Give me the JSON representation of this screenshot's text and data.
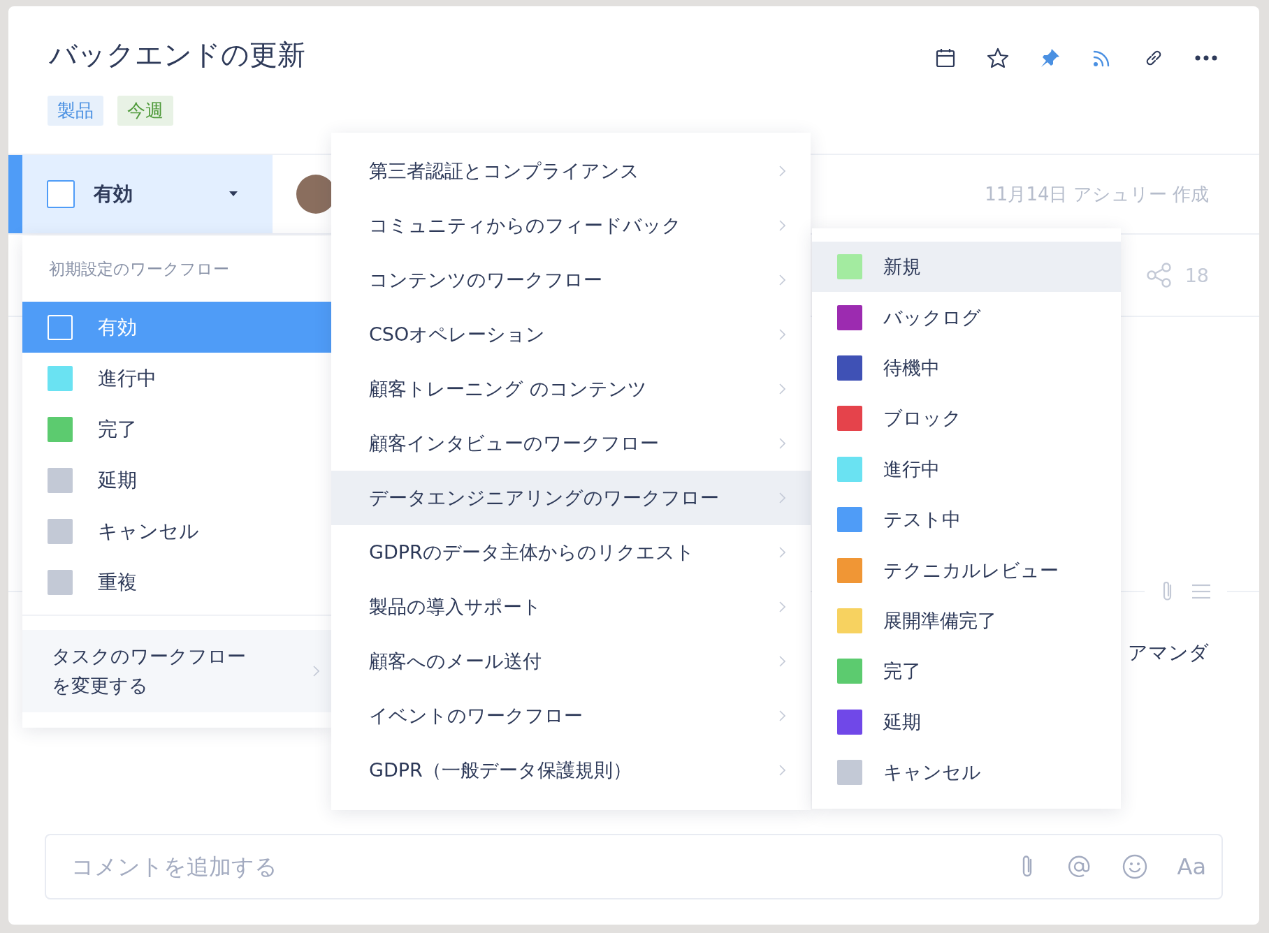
{
  "task": {
    "title": "バックエンドの更新",
    "tags": [
      {
        "label": "製品",
        "color": "#4a90e2"
      },
      {
        "label": "今週",
        "color": "#4f9a3a"
      }
    ]
  },
  "status_button": {
    "label": "有効"
  },
  "meta": {
    "created": "11月14日 アシュリー 作成",
    "share_count": "18",
    "assignee": "アマンダ"
  },
  "status_menu": {
    "header": "初期設定のワークフロー",
    "change_workflow": "タスクのワークフローを変更する",
    "items": [
      {
        "label": "有効",
        "kind": "empty",
        "selected": true
      },
      {
        "label": "進行中",
        "kind": "swatch",
        "color": "#6ae2f2",
        "selected": false
      },
      {
        "label": "完了",
        "kind": "swatch",
        "color": "#5ccb6f",
        "selected": false
      },
      {
        "label": "延期",
        "kind": "swatch",
        "color": "#c3c9d6",
        "selected": false
      },
      {
        "label": "キャンセル",
        "kind": "swatch",
        "color": "#c3c9d6",
        "selected": false
      },
      {
        "label": "重複",
        "kind": "swatch",
        "color": "#c3c9d6",
        "selected": false
      }
    ]
  },
  "workflow_menu": {
    "items": [
      {
        "label": "第三者認証とコンプライアンス",
        "selected": false
      },
      {
        "label": "コミュニティからのフィードバック",
        "selected": false
      },
      {
        "label": "コンテンツのワークフロー",
        "selected": false
      },
      {
        "label": "CSOオペレーション",
        "selected": false
      },
      {
        "label": "顧客トレーニング のコンテンツ",
        "selected": false
      },
      {
        "label": "顧客インタビューのワークフロー",
        "selected": false
      },
      {
        "label": "データエンジニアリングのワークフロー",
        "selected": true
      },
      {
        "label": "GDPRのデータ主体からのリクエスト",
        "selected": false
      },
      {
        "label": "製品の導入サポート",
        "selected": false
      },
      {
        "label": "顧客へのメール送付",
        "selected": false
      },
      {
        "label": "イベントのワークフロー",
        "selected": false
      },
      {
        "label": "GDPR（一般データ保護規則）",
        "selected": false
      }
    ]
  },
  "status_submenu": {
    "items": [
      {
        "label": "新規",
        "color": "#a3eba0",
        "selected": true
      },
      {
        "label": "バックログ",
        "color": "#9c2bb0",
        "selected": false
      },
      {
        "label": "待機中",
        "color": "#3f51b5",
        "selected": false
      },
      {
        "label": "ブロック",
        "color": "#e5434b",
        "selected": false
      },
      {
        "label": "進行中",
        "color": "#6ae2f2",
        "selected": false
      },
      {
        "label": "テスト中",
        "color": "#4f9cf7",
        "selected": false
      },
      {
        "label": "テクニカルレビュー",
        "color": "#f09635",
        "selected": false
      },
      {
        "label": "展開準備完了",
        "color": "#f7d260",
        "selected": false
      },
      {
        "label": "完了",
        "color": "#5ccb6f",
        "selected": false
      },
      {
        "label": "延期",
        "color": "#7048e8",
        "selected": false
      },
      {
        "label": "キャンセル",
        "color": "#c3c9d6",
        "selected": false
      }
    ]
  },
  "comment": {
    "placeholder": "コメントを追加する",
    "format_label": "Aa"
  }
}
